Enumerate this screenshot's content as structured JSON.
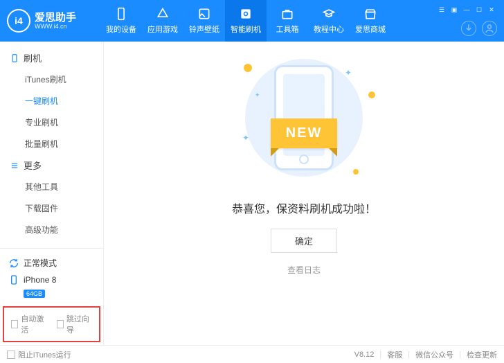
{
  "logo": {
    "mark": "i4",
    "title": "爱思助手",
    "subtitle": "WWW.i4.cn"
  },
  "nav": [
    {
      "label": "我的设备"
    },
    {
      "label": "应用游戏"
    },
    {
      "label": "铃声壁纸"
    },
    {
      "label": "智能刷机"
    },
    {
      "label": "工具箱"
    },
    {
      "label": "教程中心"
    },
    {
      "label": "爱思商城"
    }
  ],
  "sidebar": {
    "section1": "刷机",
    "items1": [
      "iTunes刷机",
      "一键刷机",
      "专业刷机",
      "批量刷机"
    ],
    "section2": "更多",
    "items2": [
      "其他工具",
      "下载固件",
      "高级功能"
    ]
  },
  "device": {
    "mode": "正常模式",
    "model": "iPhone 8",
    "storage": "64GB"
  },
  "options": {
    "auto_activate": "自动激活",
    "skip_guide": "跳过向导"
  },
  "result": {
    "banner": "NEW",
    "message": "恭喜您，保资料刷机成功啦！",
    "ok": "确定",
    "log": "查看日志"
  },
  "footer": {
    "block_itunes": "阻止iTunes运行",
    "version": "V8.12",
    "support": "客服",
    "wechat": "微信公众号",
    "update": "检查更新"
  }
}
